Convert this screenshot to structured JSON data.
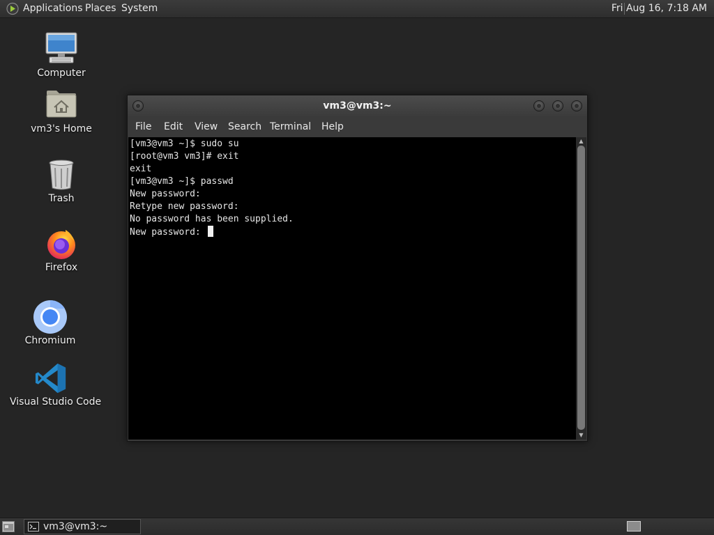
{
  "top_panel": {
    "menus": [
      "Applications",
      "Places",
      "System"
    ],
    "clock": "Fri Aug 16,  7:18 AM"
  },
  "desktop_icons": [
    {
      "label": "Computer",
      "icon": "computer-icon"
    },
    {
      "label": "vm3's Home",
      "icon": "home-folder-icon"
    },
    {
      "label": "Trash",
      "icon": "trash-icon"
    },
    {
      "label": "Firefox",
      "icon": "firefox-icon"
    },
    {
      "label": "Chromium",
      "icon": "chromium-icon"
    },
    {
      "label": "Visual Studio Code",
      "icon": "vscode-icon"
    }
  ],
  "terminal": {
    "title": "vm3@vm3:~",
    "menus": [
      "File",
      "Edit",
      "View",
      "Search",
      "Terminal",
      "Help"
    ],
    "lines": [
      "[vm3@vm3 ~]$ sudo su",
      "[root@vm3 vm3]# exit",
      "exit",
      "[vm3@vm3 ~]$ passwd",
      "New password:",
      "Retype new password:",
      "No password has been supplied.",
      "New password: "
    ]
  },
  "taskbar": {
    "task_label": "vm3@vm3:~"
  },
  "colors": {
    "desktop_bg": "#252525",
    "terminal_bg": "#000000",
    "terminal_fg": "#e6e6e6",
    "vscode_blue": "#2489ca",
    "chromium_blue": "#4587f4"
  }
}
